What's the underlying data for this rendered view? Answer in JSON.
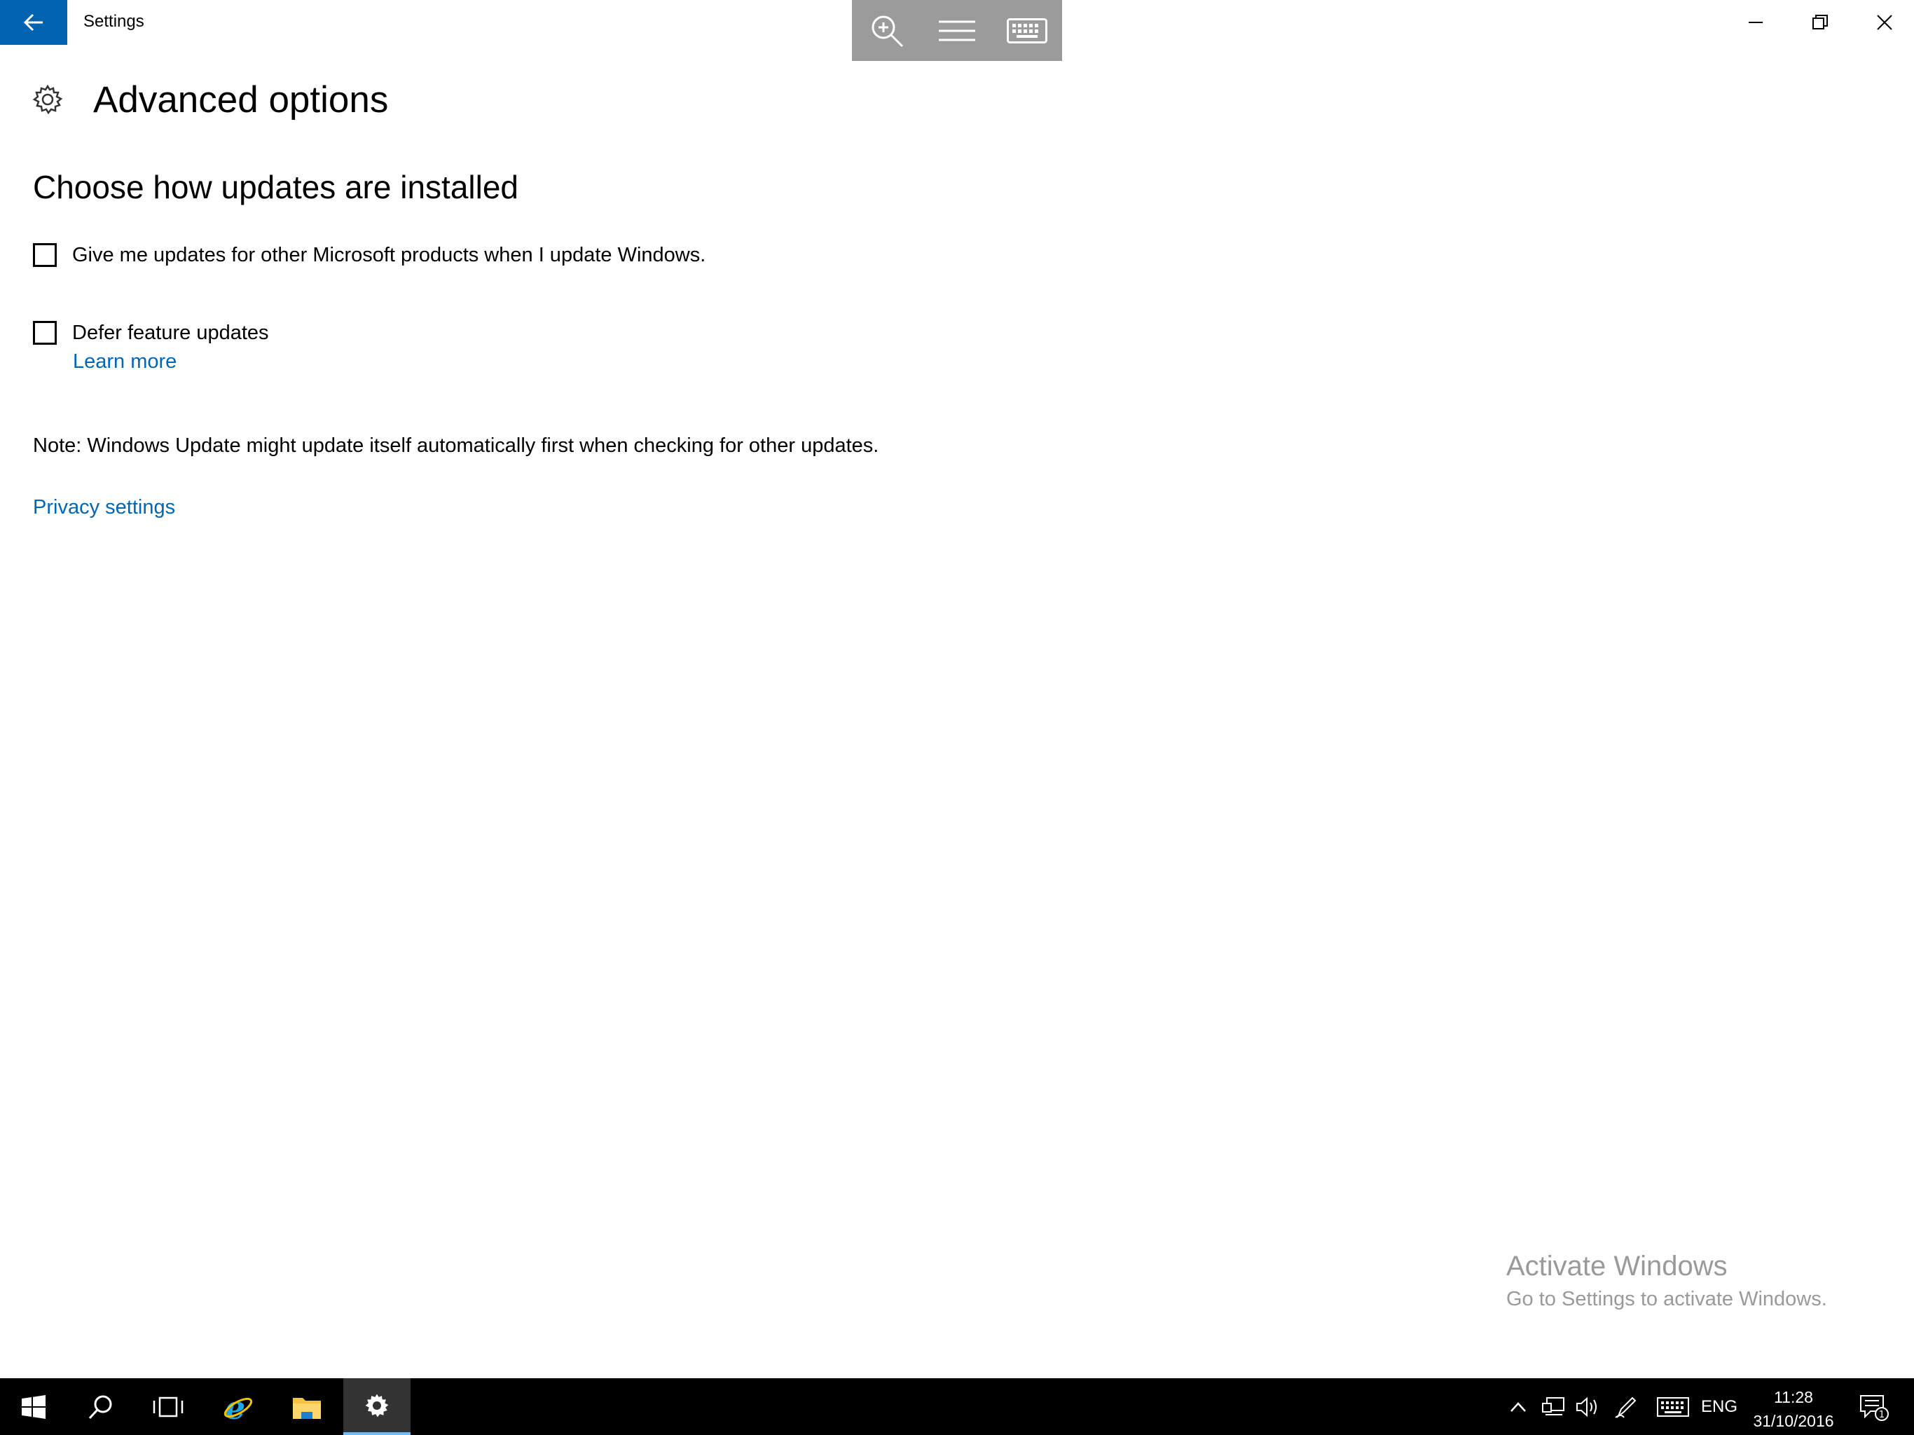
{
  "window": {
    "title": "Settings"
  },
  "page": {
    "title": "Advanced options",
    "section_title": "Choose how updates are installed",
    "options": [
      {
        "label": "Give me updates for other Microsoft products when I update Windows.",
        "checked": false
      },
      {
        "label": "Defer feature updates",
        "checked": false
      }
    ],
    "learn_more": "Learn more",
    "note": "Note: Windows Update might update itself automatically first when checking for other updates.",
    "privacy_link": "Privacy settings"
  },
  "watermark": {
    "line1": "Activate Windows",
    "line2": "Go to Settings to activate Windows."
  },
  "taskbar": {
    "language": "ENG",
    "time": "11:28",
    "date": "31/10/2016",
    "notification_count": "1"
  },
  "colors": {
    "accent": "#0063b1",
    "link": "#0067b8",
    "toolbar": "#9b9b9b",
    "taskbar": "#000000"
  }
}
